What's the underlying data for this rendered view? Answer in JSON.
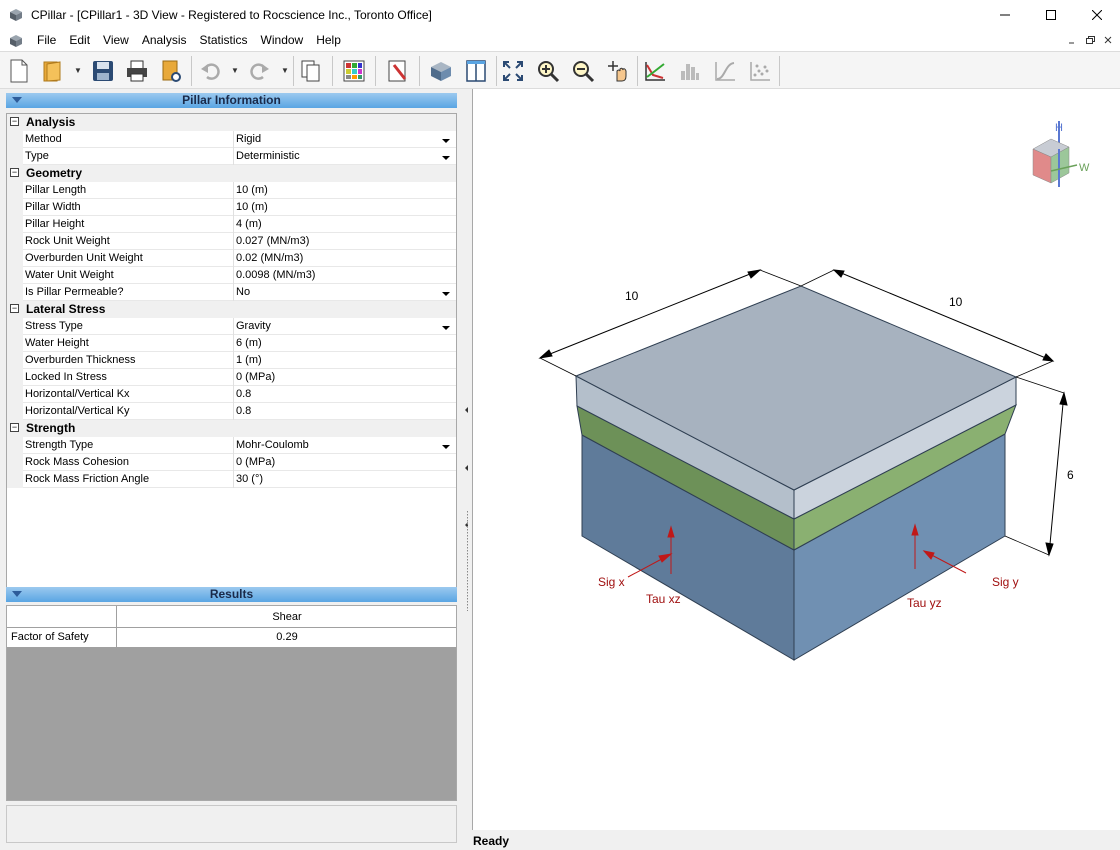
{
  "window": {
    "title": "CPillar - [CPillar1 - 3D View - Registered to Rocscience Inc., Toronto Office]",
    "minimize": "—",
    "maximize": "☐",
    "close": "✕"
  },
  "menu": {
    "items": [
      "File",
      "Edit",
      "View",
      "Analysis",
      "Statistics",
      "Window",
      "Help"
    ],
    "mdi_minimize": "_",
    "mdi_restore": "❐",
    "mdi_close": "✕"
  },
  "toolbar": {
    "icons": [
      "new-file-icon",
      "open-folder-icon",
      "save-icon",
      "print-icon",
      "print-preview-icon",
      "undo-icon",
      "redo-icon",
      "copy-icon",
      "color-palette-icon",
      "edit-icon",
      "3d-box-icon",
      "tile-vertical-icon",
      "zoom-all-icon",
      "zoom-in-icon",
      "zoom-out-icon",
      "pan-icon",
      "chart-line-icon",
      "histogram-icon",
      "cumulative-icon",
      "scatter-icon"
    ]
  },
  "pillar_info": {
    "header": "Pillar Information",
    "categories": [
      {
        "name": "Analysis",
        "props": [
          {
            "name": "Method",
            "value": "Rigid",
            "dropdown": true
          },
          {
            "name": "Type",
            "value": "Deterministic",
            "dropdown": true
          }
        ]
      },
      {
        "name": "Geometry",
        "props": [
          {
            "name": "Pillar Length",
            "value": "10 (m)",
            "dropdown": false
          },
          {
            "name": "Pillar Width",
            "value": "10 (m)",
            "dropdown": false
          },
          {
            "name": "Pillar Height",
            "value": "4 (m)",
            "dropdown": false
          },
          {
            "name": "Rock Unit Weight",
            "value": "0.027 (MN/m3)",
            "dropdown": false
          },
          {
            "name": "Overburden Unit Weight",
            "value": "0.02 (MN/m3)",
            "dropdown": false
          },
          {
            "name": "Water Unit Weight",
            "value": "0.0098 (MN/m3)",
            "dropdown": false
          },
          {
            "name": "Is Pillar Permeable?",
            "value": "No",
            "dropdown": true
          }
        ]
      },
      {
        "name": "Lateral Stress",
        "props": [
          {
            "name": "Stress Type",
            "value": "Gravity",
            "dropdown": true
          },
          {
            "name": "Water Height",
            "value": "6 (m)",
            "dropdown": false
          },
          {
            "name": "Overburden Thickness",
            "value": "1 (m)",
            "dropdown": false
          },
          {
            "name": "Locked In Stress",
            "value": "0 (MPa)",
            "dropdown": false
          },
          {
            "name": "Horizontal/Vertical Kx",
            "value": "0.8",
            "dropdown": false
          },
          {
            "name": "Horizontal/Vertical Ky",
            "value": "0.8",
            "dropdown": false
          }
        ]
      },
      {
        "name": "Strength",
        "props": [
          {
            "name": "Strength Type",
            "value": "Mohr-Coulomb",
            "dropdown": true
          },
          {
            "name": "Rock Mass Cohesion",
            "value": "0 (MPa)",
            "dropdown": false
          },
          {
            "name": "Rock Mass Friction Angle",
            "value": "30 (°)",
            "dropdown": false
          }
        ]
      }
    ]
  },
  "results": {
    "header": "Results",
    "column": "Shear",
    "row_label": "Factor of Safety",
    "row_value": "0.29"
  },
  "view": {
    "dim_length": "10",
    "dim_width": "10",
    "dim_height": "6",
    "label_sig_x": "Sig x",
    "label_tau_xz": "Tau xz",
    "label_sig_y": "Sig y",
    "label_tau_yz": "Tau yz",
    "axis_h": "H",
    "axis_w": "W",
    "colors": {
      "top_face": "#a7b2bf",
      "overburden_face": "#c3ccd6",
      "water_band": "#7ea067",
      "rock_left": "#5f7b9a",
      "rock_right": "#7090b2",
      "stress_label": "#a01010"
    }
  },
  "status": {
    "text": "Ready"
  }
}
